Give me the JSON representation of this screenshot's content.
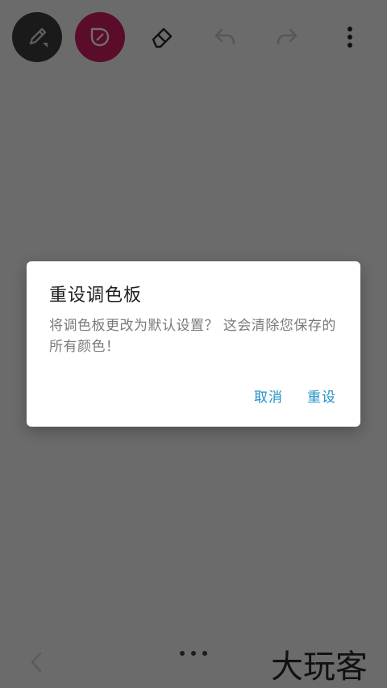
{
  "toolbar": {
    "tools": [
      {
        "name": "pen",
        "icon": "pen-icon",
        "bg": "#1a1a1a"
      },
      {
        "name": "color",
        "icon": "droplet-icon",
        "bg": "#5a0c2a"
      },
      {
        "name": "eraser",
        "icon": "eraser-icon"
      },
      {
        "name": "undo",
        "icon": "undo-icon"
      },
      {
        "name": "redo",
        "icon": "redo-icon"
      },
      {
        "name": "more",
        "icon": "more-vertical-icon"
      }
    ]
  },
  "dialog": {
    "title": "重设调色板",
    "message": "将调色板更改为默认设置？ 这会清除您保存的所有颜色！",
    "cancel_label": "取消",
    "confirm_label": "重设",
    "accent_color": "#1d91c7"
  },
  "bottom_bar": {
    "back_icon": "chevron-left-icon",
    "more_icon": "more-horizontal-icon",
    "watermark": "大玩客"
  }
}
